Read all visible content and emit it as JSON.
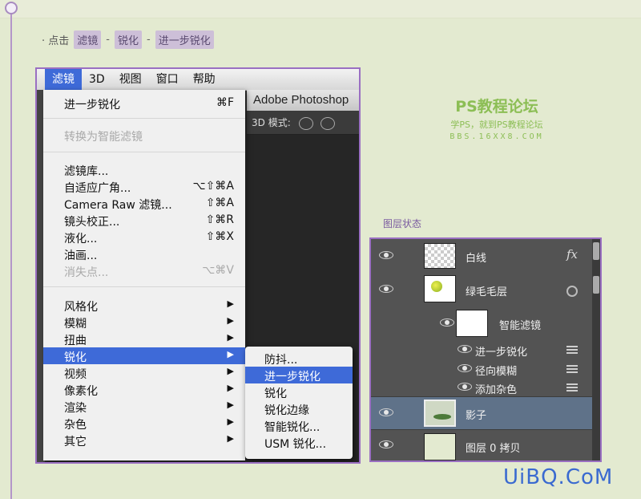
{
  "instruction": {
    "prefix": "· 点击",
    "step1": "滤镜",
    "sep1": "-",
    "step2": "锐化",
    "sep2": "-",
    "step3": "进一步锐化"
  },
  "menubar": [
    "滤镜",
    "3D",
    "视图",
    "窗口",
    "帮助"
  ],
  "app_title": "Adobe Photoshop",
  "options_bar_label": "3D 模式:",
  "filter_menu": {
    "groups": [
      [
        {
          "label": "进一步锐化",
          "shortcut": "⌘F"
        }
      ],
      [
        {
          "label": "转换为智能滤镜",
          "disabled": true
        }
      ],
      [
        {
          "label": "滤镜库..."
        },
        {
          "label": "自适应广角...",
          "shortcut": "⌥⇧⌘A"
        },
        {
          "label": "Camera Raw 滤镜...",
          "shortcut": "⇧⌘A"
        },
        {
          "label": "镜头校正...",
          "shortcut": "⇧⌘R"
        },
        {
          "label": "液化...",
          "shortcut": "⇧⌘X"
        },
        {
          "label": "油画..."
        },
        {
          "label": "消失点...",
          "shortcut": "⌥⌘V",
          "disabled": true
        }
      ],
      [
        {
          "label": "风格化",
          "submenu": true
        },
        {
          "label": "模糊",
          "submenu": true
        },
        {
          "label": "扭曲",
          "submenu": true
        },
        {
          "label": "锐化",
          "submenu": true,
          "highlighted": true
        },
        {
          "label": "视频",
          "submenu": true
        },
        {
          "label": "像素化",
          "submenu": true
        },
        {
          "label": "渲染",
          "submenu": true
        },
        {
          "label": "杂色",
          "submenu": true
        },
        {
          "label": "其它",
          "submenu": true
        }
      ]
    ]
  },
  "sharpen_submenu": [
    {
      "label": "防抖..."
    },
    {
      "label": "进一步锐化",
      "highlighted": true
    },
    {
      "label": "锐化"
    },
    {
      "label": "锐化边缘"
    },
    {
      "label": "智能锐化..."
    },
    {
      "label": "USM 锐化..."
    }
  ],
  "watermark": {
    "title": "PS教程论坛",
    "subtitle": "学PS，就到PS教程论坛",
    "url": "BBS.16XX8.COM"
  },
  "layers_caption": "图层状态",
  "layers": {
    "rows": [
      {
        "name": "白线",
        "badge": "fx"
      },
      {
        "name": "绿毛毛层"
      },
      {
        "name": "智能滤镜"
      },
      {
        "name": "进一步锐化"
      },
      {
        "name": "径向模糊"
      },
      {
        "name": "添加杂色"
      },
      {
        "name": "影子",
        "selected": true
      },
      {
        "name": "图层 0 拷贝"
      }
    ]
  },
  "site_logo": "UiBQ.CoM",
  "colors": {
    "page_bg": "#e3ead0",
    "accent_purple": "#9a6fc2",
    "menu_highlight": "#3e6ad8",
    "watermark_green": "#8cbe55"
  }
}
